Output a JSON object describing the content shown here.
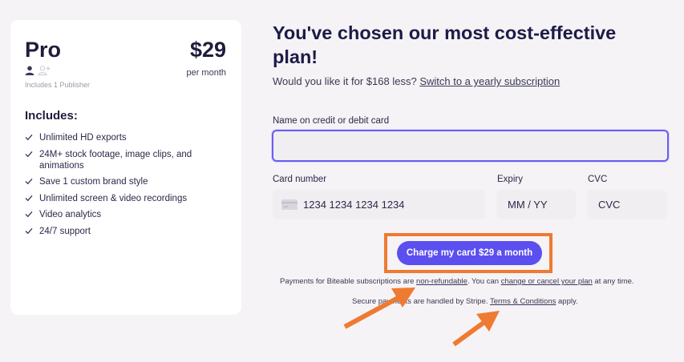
{
  "plan": {
    "name": "Pro",
    "price": "$29",
    "period": "per month",
    "publisher_note": "Includes 1 Publisher",
    "includes_heading": "Includes:",
    "features": [
      "Unlimited HD exports",
      "24M+ stock footage, image clips, and animations",
      "Save 1 custom brand style",
      "Unlimited screen & video recordings",
      "Video analytics",
      "24/7 support"
    ]
  },
  "checkout": {
    "headline": "You've chosen our most cost-effective plan!",
    "offer_text": "Would you like it for $168 less?",
    "offer_link": "Switch to a yearly subscription",
    "name_label": "Name on credit or debit card",
    "name_value": "",
    "card_label": "Card number",
    "card_placeholder": "1234 1234 1234 1234",
    "expiry_label": "Expiry",
    "expiry_placeholder": "MM / YY",
    "cvc_label": "CVC",
    "cvc_placeholder": "CVC",
    "charge_button": "Charge my card $29 a month",
    "fine1_pre": "Payments for Biteable subscriptions are",
    "fine1_link1": "non-refundable",
    "fine1_mid": ". You can",
    "fine1_link2": "change or cancel your plan",
    "fine1_post": "at any time.",
    "fine2_pre": "Secure payments are handled by Stripe.",
    "fine2_link": "Terms & Conditions",
    "fine2_post": "apply."
  },
  "colors": {
    "accent": "#5b4ff0",
    "annotation": "#ef7a32",
    "background": "#f5f3f5"
  },
  "icons": [
    "user-icon",
    "add-user-icon",
    "check-icon",
    "credit-card-icon",
    "arrow-annotation-icon"
  ]
}
